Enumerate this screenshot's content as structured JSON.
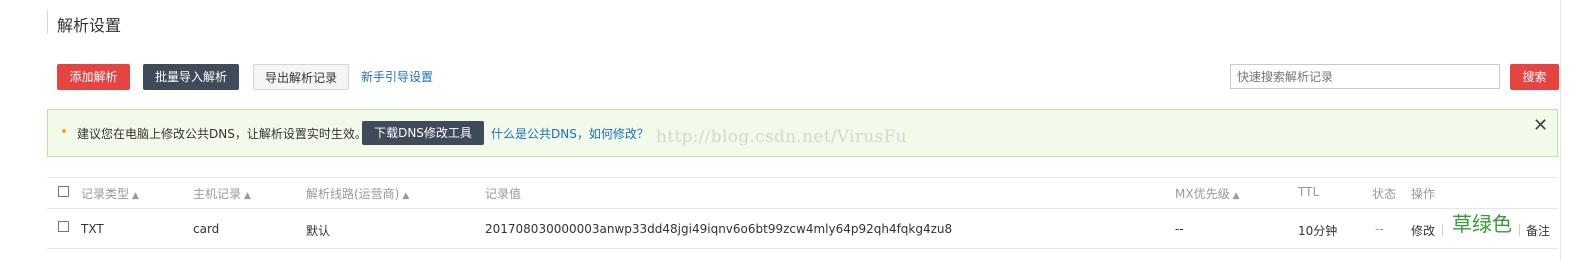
{
  "page": {
    "title": "解析设置"
  },
  "toolbar": {
    "add_label": "添加解析",
    "import_label": "批量导入解析",
    "export_label": "导出解析记录",
    "guide_label": "新手引导设置",
    "search_placeholder": "快速搜索解析记录",
    "search_label": "搜索"
  },
  "notice": {
    "text": "建议您在电脑上修改公共DNS，让解析设置实时生效。",
    "download_label": "下载DNS修改工具",
    "faq_label": "什么是公共DNS，如何修改？",
    "watermark": "http://blog.csdn.net/VirusFu",
    "close_glyph": "✕"
  },
  "table": {
    "columns": [
      "记录类型",
      "主机记录",
      "解析线路(运营商)",
      "记录值",
      "MX优先级",
      "TTL",
      "状态",
      "操作"
    ],
    "sort_glyph": "▲",
    "rows": [
      {
        "type": "TXT",
        "host": "card",
        "line": "默认",
        "value": "201708030000003anwp33dd48jgi49iqnv6o6bt99zcw4mly64p92qh4fqkg4zu8",
        "mx": "--",
        "ttl": "10分钟",
        "status": "--",
        "actions": {
          "edit": "修改",
          "note": "备注"
        }
      }
    ]
  },
  "overlay": {
    "green_text": "草绿色"
  },
  "colors": {
    "primary_red": "#e64343",
    "dark_button": "#3f4a5a",
    "link_blue": "#1a6fc2",
    "notice_bg": "#f2fbe9",
    "notice_border": "#bde3a4"
  }
}
